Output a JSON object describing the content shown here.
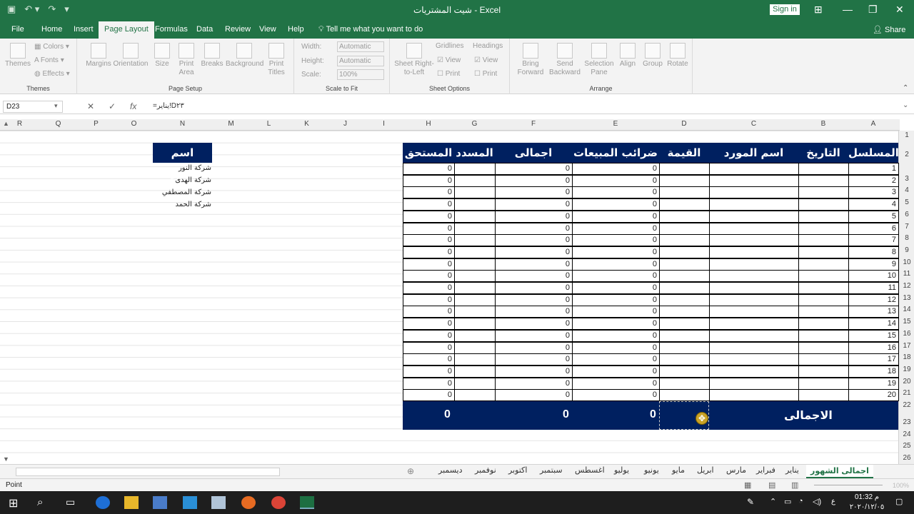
{
  "titlebar": {
    "app": "Excel",
    "doc": "شيت المشتريات",
    "sep": "-",
    "signin": "Sign in"
  },
  "tabs": [
    "File",
    "Home",
    "Insert",
    "Page Layout",
    "Formulas",
    "Data",
    "Review",
    "View",
    "Help"
  ],
  "tell": "Tell me what you want to do",
  "share": "Share",
  "ribbon": {
    "themes": {
      "label": "Themes",
      "btn": "Themes",
      "colors": "Colors",
      "fonts": "Fonts",
      "effects": "Effects"
    },
    "pagesetup": {
      "label": "Page Setup",
      "buttons": [
        "Margins",
        "Orientation",
        "Size",
        "Print Area",
        "Breaks",
        "Background",
        "Print Titles"
      ]
    },
    "scale": {
      "label": "Scale to Fit",
      "width": "Width:",
      "height": "Height:",
      "scale": "Scale:",
      "auto": "Automatic",
      "pct": "100%"
    },
    "sheetopts": {
      "label": "Sheet Options",
      "rtl": "Sheet Right-to-Left",
      "gridlines": "Gridlines",
      "headings": "Headings",
      "view": "View",
      "print": "Print"
    },
    "arrange": {
      "label": "Arrange",
      "buttons": [
        "Bring Forward",
        "Send Backward",
        "Selection Pane",
        "Align",
        "Group",
        "Rotate"
      ]
    }
  },
  "formulabar": {
    "namebox": "D23",
    "formula": "=يناير!D٢٣"
  },
  "columns": [
    "R",
    "Q",
    "P",
    "O",
    "N",
    "M",
    "L",
    "K",
    "J",
    "I",
    "H",
    "G",
    "F",
    "E",
    "D",
    "C",
    "B",
    "A"
  ],
  "rows": [
    "1",
    "2",
    "3",
    "4",
    "5",
    "6",
    "7",
    "8",
    "9",
    "10",
    "11",
    "12",
    "13",
    "14",
    "15",
    "16",
    "17",
    "18",
    "19",
    "20",
    "21",
    "22",
    "23",
    "24",
    "25",
    "26"
  ],
  "table": {
    "headers": {
      "serial": "المسلسل",
      "date": "التاريخ",
      "supplier": "اسم المورد",
      "value": "القيمة",
      "tax": "ضرائب المبيعات",
      "total": "اجمالى الفواتير",
      "paid": "المسدد",
      "due": "المستحق"
    },
    "serials": [
      "1",
      "2",
      "3",
      "4",
      "5",
      "6",
      "7",
      "8",
      "9",
      "10",
      "11",
      "12",
      "13",
      "14",
      "15",
      "16",
      "17",
      "18",
      "19",
      "20"
    ],
    "zero": "0",
    "total_label": "الاجمالى",
    "totals": {
      "tax": "0",
      "total": "0",
      "due": "0"
    }
  },
  "suppliers": {
    "header": "اسم المورد",
    "items": [
      "شركة النور",
      "شركة الهدى",
      "شركة المصطفي",
      "شركة الحمد"
    ]
  },
  "sheets": [
    "اجمالى الشهور",
    "يناير",
    "فبراير",
    "مارس",
    "ابريل",
    "مايو",
    "يونيو",
    "يوليو",
    "اغسطس",
    "سبتمبر",
    "اكتوبر",
    "نوفمبر",
    "ديسمبر"
  ],
  "status": {
    "mode": "Point",
    "zoom": "100%"
  },
  "clock": {
    "time": "01:32 م",
    "date": "٢٠٢٠/١٢/٠٥",
    "lang": "ع"
  }
}
